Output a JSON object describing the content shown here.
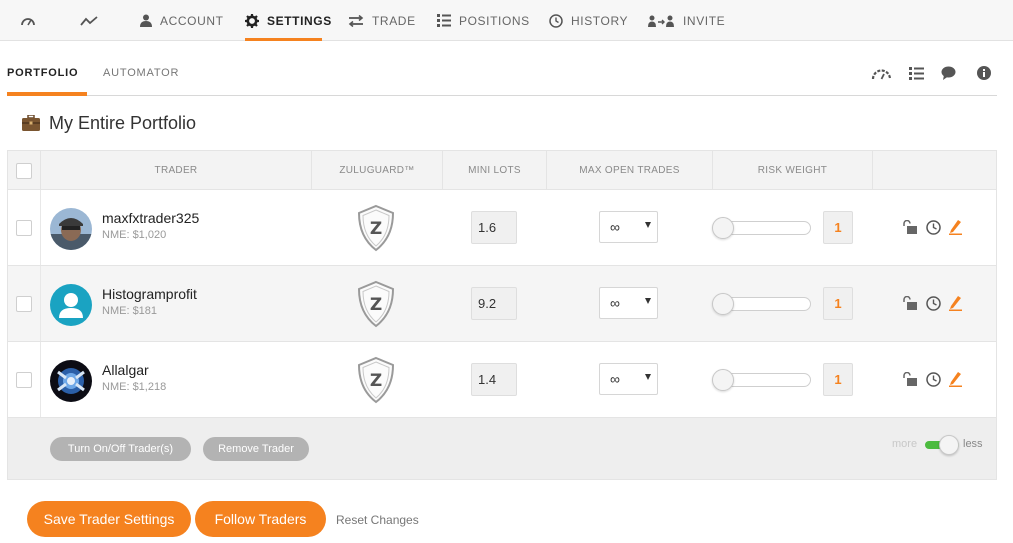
{
  "topnav": {
    "items": [
      {
        "label": "",
        "icon": "speedometer-icon"
      },
      {
        "label": "",
        "icon": "chart-line-icon"
      },
      {
        "label": "ACCOUNT",
        "icon": "user-icon"
      },
      {
        "label": "SETTINGS",
        "icon": "gear-icon"
      },
      {
        "label": "TRADE",
        "icon": "swap-arrows-icon"
      },
      {
        "label": "POSITIONS",
        "icon": "list-icon"
      },
      {
        "label": "HISTORY",
        "icon": "clock-icon"
      },
      {
        "label": "INVITE",
        "icon": "invite-users-icon"
      }
    ],
    "active": "SETTINGS"
  },
  "subnav": {
    "tabs": [
      "PORTFOLIO",
      "AUTOMATOR"
    ],
    "active": "PORTFOLIO",
    "icons": [
      "speedometer-icon",
      "list-icon",
      "chat-bubble-icon",
      "info-icon"
    ]
  },
  "portfolio": {
    "title": "My Entire Portfolio",
    "icon": "briefcase-icon"
  },
  "table": {
    "headers": [
      "TRADER",
      "ZULUGUARD™",
      "MINI LOTS",
      "MAX OPEN TRADES",
      "RISK WEIGHT"
    ],
    "rows": [
      {
        "name": "maxfxtrader325",
        "nme_label": "NME:",
        "nme_value": "$1,020",
        "mini_lots": "1.6",
        "max_open_trades": "∞",
        "risk_weight": "1",
        "slider_fraction": 0
      },
      {
        "name": "Histogramprofit",
        "nme_label": "NME:",
        "nme_value": "$181",
        "mini_lots": "9.2",
        "max_open_trades": "∞",
        "risk_weight": "1",
        "slider_fraction": 0
      },
      {
        "name": "Allalgar",
        "nme_label": "NME:",
        "nme_value": "$1,218",
        "mini_lots": "1.4",
        "max_open_trades": "∞",
        "risk_weight": "1",
        "slider_fraction": 0
      }
    ],
    "footer": {
      "toggle_button": "Turn On/Off Trader(s)",
      "remove_button": "Remove Trader",
      "more_label": "more",
      "less_label": "less",
      "toggle_state": "less"
    }
  },
  "actions": {
    "save": "Save Trader Settings",
    "follow": "Follow Traders",
    "reset": "Reset Changes"
  },
  "colors": {
    "accent": "#f5821f",
    "toggle_on": "#4cbb3f",
    "gray_button": "#b3b3b3"
  }
}
